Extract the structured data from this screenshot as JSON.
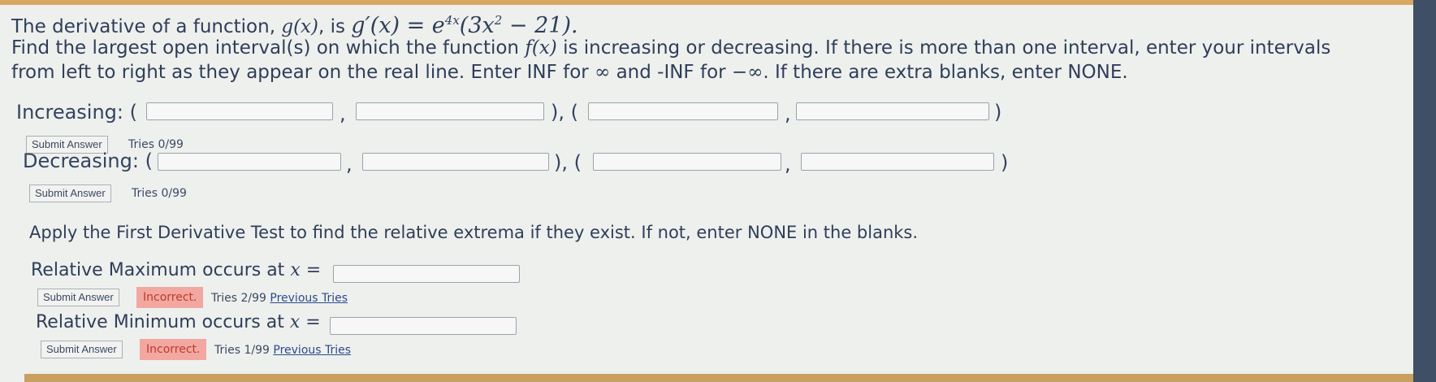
{
  "question": {
    "intro_text": "The derivative of a function,",
    "g_of_x": "g(x)",
    "comma_is": ", is",
    "gprime": "g′(x) = e",
    "exp": "4x",
    "paren_expr": "(3x",
    "square": "2",
    "tail": " − 21).",
    "line2": "Find the largest open interval(s) on which the function",
    "f_of_x": "f(x)",
    "line2b": "is increasing or decreasing. If there is more than one interval, enter your intervals",
    "line3a": "from left to right as they appear on the real line. Enter INF for",
    "inf_symbol": "∞",
    "line3b": "and -INF for",
    "neg_inf": "−∞",
    "line3c": ". If there are extra blanks, enter NONE."
  },
  "increasing": {
    "label": "Increasing: (",
    "sep1": ",",
    "mid": "), (",
    "sep2": ",",
    "close": ")",
    "submit": "Submit Answer",
    "tries": "Tries 0/99",
    "fields": [
      "",
      "",
      "",
      ""
    ]
  },
  "decreasing": {
    "label": "Decreasing: (",
    "sep1": ",",
    "mid": "), (",
    "sep2": ",",
    "close": ")",
    "submit": "Submit Answer",
    "tries": "Tries 0/99",
    "fields": [
      "",
      "",
      "",
      ""
    ]
  },
  "extrema": {
    "instruction": "Apply the First Derivative Test to find the relative extrema if they exist. If not, enter NONE in the blanks.",
    "max_label": "Relative Maximum occurs at",
    "min_label": "Relative Minimum occurs at",
    "x_eq": "x =",
    "max_value": "",
    "min_value": "",
    "max_submit": "Submit Answer",
    "max_status": "Incorrect.",
    "max_tries": "Tries 2/99",
    "max_prev": "Previous Tries",
    "min_submit": "Submit Answer",
    "min_status": "Incorrect.",
    "min_tries": "Tries 1/99",
    "min_prev": "Previous Tries"
  },
  "colors": {
    "incorrect_bg": "#f2a8a0",
    "incorrect_text": "#c0392b"
  }
}
